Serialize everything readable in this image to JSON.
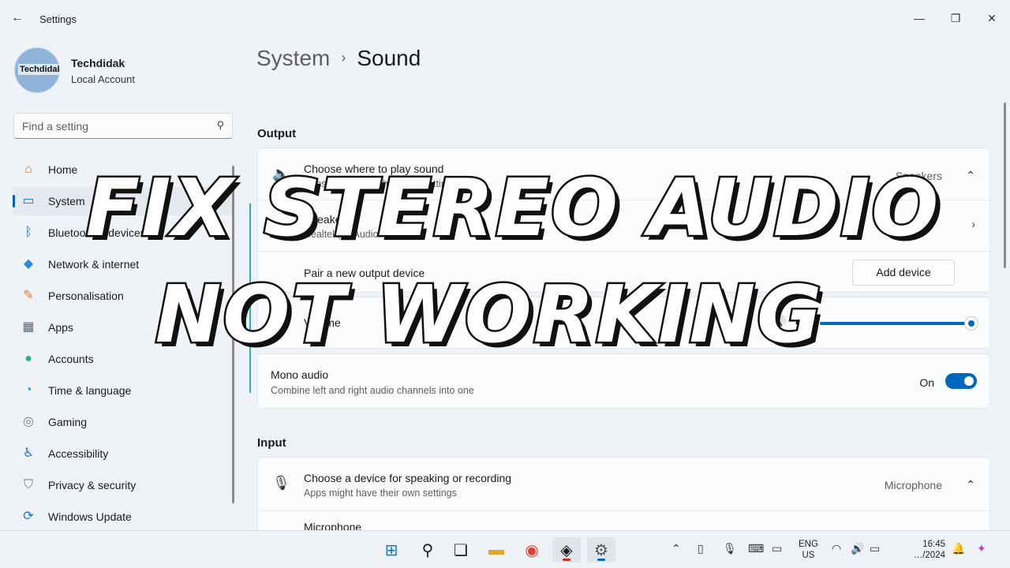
{
  "app": {
    "title": "Settings"
  },
  "profile": {
    "name": "Techdidak",
    "account": "Local Account",
    "avatar_text": "Techdidak"
  },
  "search": {
    "placeholder": "Find a setting"
  },
  "nav": {
    "items": [
      {
        "label": "Home",
        "icon": "home-icon",
        "glyph": "⌂",
        "color": "#e57a2e"
      },
      {
        "label": "System",
        "icon": "system-icon",
        "glyph": "▭",
        "color": "#1a73c8",
        "active": true
      },
      {
        "label": "Bluetooth & devices",
        "icon": "bluetooth-icon",
        "glyph": "ᛒ",
        "color": "#1a73c8"
      },
      {
        "label": "Network & internet",
        "icon": "wifi-icon",
        "glyph": "◆",
        "color": "#2b8fd8"
      },
      {
        "label": "Personalisation",
        "icon": "brush-icon",
        "glyph": "✎",
        "color": "#d47a3a"
      },
      {
        "label": "Apps",
        "icon": "apps-icon",
        "glyph": "▦",
        "color": "#5a6b80"
      },
      {
        "label": "Accounts",
        "icon": "accounts-icon",
        "glyph": "●",
        "color": "#2bb08a"
      },
      {
        "label": "Time & language",
        "icon": "time-language-icon",
        "glyph": "◔",
        "color": "#2b8fd8"
      },
      {
        "label": "Gaming",
        "icon": "gaming-icon",
        "glyph": "◎",
        "color": "#7a7a7a"
      },
      {
        "label": "Accessibility",
        "icon": "accessibility-icon",
        "glyph": "♿",
        "color": "#1a73c8"
      },
      {
        "label": "Privacy & security",
        "icon": "shield-icon",
        "glyph": "⛉",
        "color": "#7a7a7a"
      },
      {
        "label": "Windows Update",
        "icon": "update-icon",
        "glyph": "⟳",
        "color": "#1a73c8"
      }
    ]
  },
  "breadcrumb": {
    "parent": "System",
    "current": "Sound"
  },
  "output": {
    "section_title": "Output",
    "choose": {
      "title": "Choose where to play sound",
      "subtitle": "Apps might have their own settings",
      "value": "Speakers"
    },
    "speakers": {
      "title": "Speakers",
      "subtitle": "Realtek(R) Audio"
    },
    "pair": {
      "title": "Pair a new output device",
      "button": "Add device"
    },
    "volume": {
      "label": "Volume",
      "value": "100",
      "level": 1.0
    },
    "mono": {
      "title": "Mono audio",
      "subtitle": "Combine left and right audio channels into one",
      "state": "On"
    }
  },
  "input": {
    "section_title": "Input",
    "choose": {
      "title": "Choose a device for speaking or recording",
      "subtitle": "Apps might have their own settings",
      "value": "Microphone"
    },
    "microphone": {
      "title": "Microphone"
    }
  },
  "overlay": {
    "line1": "FIX STEREO AUDIO",
    "line2": "NOT WORKING"
  },
  "taskbar": {
    "lang_top": "ENG",
    "lang_bottom": "US",
    "time": "16:45",
    "date": "…/2024"
  },
  "colors": {
    "accent": "#0067c0",
    "teal_indicator": "#27b3c8"
  }
}
